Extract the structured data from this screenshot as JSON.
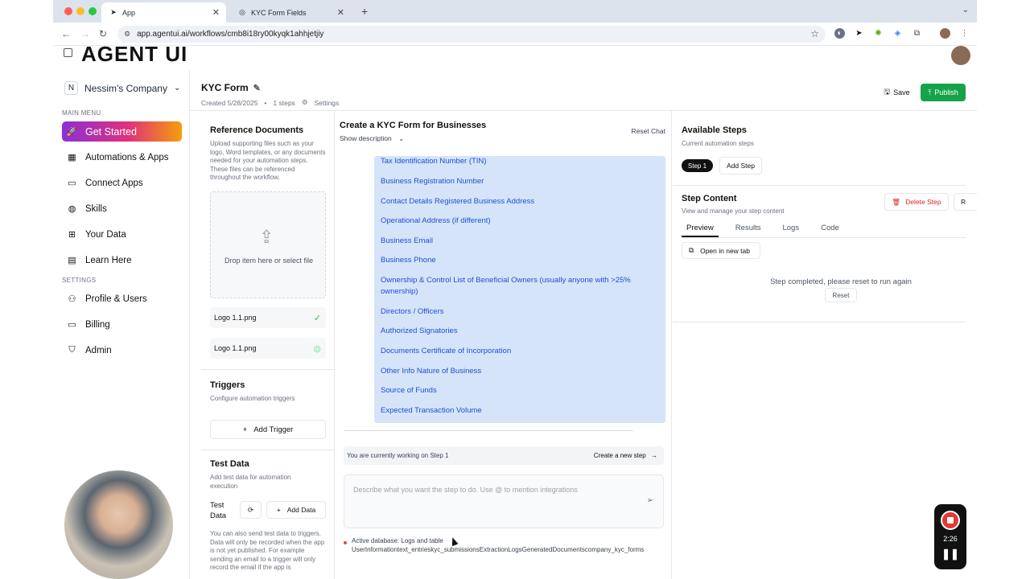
{
  "browser": {
    "tabs": [
      {
        "title": "App",
        "favicon": "send-icon",
        "active": true
      },
      {
        "title": "KYC Form Fields",
        "favicon": "openai-icon",
        "active": false
      }
    ],
    "url": "app.agentui.ai/workflows/cmb8i18ry00kyqk1ahhjetjiy"
  },
  "app": {
    "logo_text": "AGENT UI",
    "company": {
      "initial": "N",
      "name": "Nessim's Company"
    },
    "sections": {
      "main": "MAIN MENU",
      "settings": "SETTINGS"
    },
    "nav_main": [
      {
        "label": "Get Started",
        "icon": "rocket-icon",
        "active": true
      },
      {
        "label": "Automations & Apps",
        "icon": "grid-icon"
      },
      {
        "label": "Connect Apps",
        "icon": "calendar-icon"
      },
      {
        "label": "Skills",
        "icon": "globe-icon"
      },
      {
        "label": "Your Data",
        "icon": "table-icon"
      },
      {
        "label": "Learn Here",
        "icon": "book-icon"
      }
    ],
    "nav_settings": [
      {
        "label": "Profile & Users",
        "icon": "users-icon"
      },
      {
        "label": "Billing",
        "icon": "credit-card-icon"
      },
      {
        "label": "Admin",
        "icon": "shield-icon"
      }
    ]
  },
  "workflow": {
    "title": "KYC Form",
    "created": "Created 5/28/2025",
    "steps_count": "1 steps",
    "settings_label": "Settings",
    "save_label": "Save",
    "publish_label": "Publish"
  },
  "reference": {
    "title": "Reference Documents",
    "description": "Upload supporting files such as your logo, Word templates, or any documents needed for your automation steps. These files can be referenced throughout the workflow.",
    "drop_text": "Drop item here or select file",
    "files": [
      {
        "name": "Logo 1.1.png",
        "status": "done"
      },
      {
        "name": "Logo 1.1.png",
        "status": "pending"
      }
    ]
  },
  "triggers": {
    "title": "Triggers",
    "description": "Configure automation triggers",
    "add_label": "Add Trigger"
  },
  "test_data": {
    "title": "Test Data",
    "description": "Add test data for automation execution",
    "label": "Test Data",
    "add_label": "Add Data",
    "note": "You can also send test data to triggers. Data will only be recorded when the app is not yet published. For example sending an email to a trigger will only record the email if the app is"
  },
  "chat": {
    "title": "Create a KYC Form for Businesses",
    "show_description": "Show description",
    "reset_label": "Reset Chat",
    "fields": [
      "Tax Identification Number (TIN)",
      "Business Registration Number",
      "Contact Details Registered Business Address",
      "Operational Address (if different)",
      "Business Email",
      "Business Phone",
      "Ownership & Control List of Beneficial Owners (usually anyone with >25% ownership)",
      "Directors / Officers",
      "Authorized Signatories",
      "Documents Certificate of Incorporation",
      "Other Info Nature of Business",
      "Source of Funds",
      "Expected Transaction Volume"
    ],
    "working_on": "You are currently working on Step 1",
    "create_step": "Create a new step",
    "placeholder": "Describe what you want the step to do. Use @ to mention integrations",
    "db_line1": "Active database: Logs and table",
    "db_line2": "UserInformationtext_entrieskyc_submissionsExtractionLogsGeneratedDocumentscompany_kyc_forms"
  },
  "steps": {
    "title": "Available Steps",
    "description": "Current automation steps",
    "step_pill": "Step 1",
    "add_step": "Add Step",
    "content_title": "Step Content",
    "content_description": "View and manage your step content",
    "delete_label": "Delete Step",
    "r_label": "R",
    "tabs": [
      "Preview",
      "Results",
      "Logs",
      "Code"
    ],
    "active_tab": "Preview",
    "open_new_tab": "Open in new tab",
    "completed_text": "Step completed, please reset to run again",
    "reset_label": "Reset"
  },
  "recorder": {
    "time": "2:26"
  },
  "colors": {
    "publish": "#15a34a",
    "field_bg": "#d6e4f9",
    "field_text": "#1d4ed8",
    "delete": "#dc2626"
  }
}
